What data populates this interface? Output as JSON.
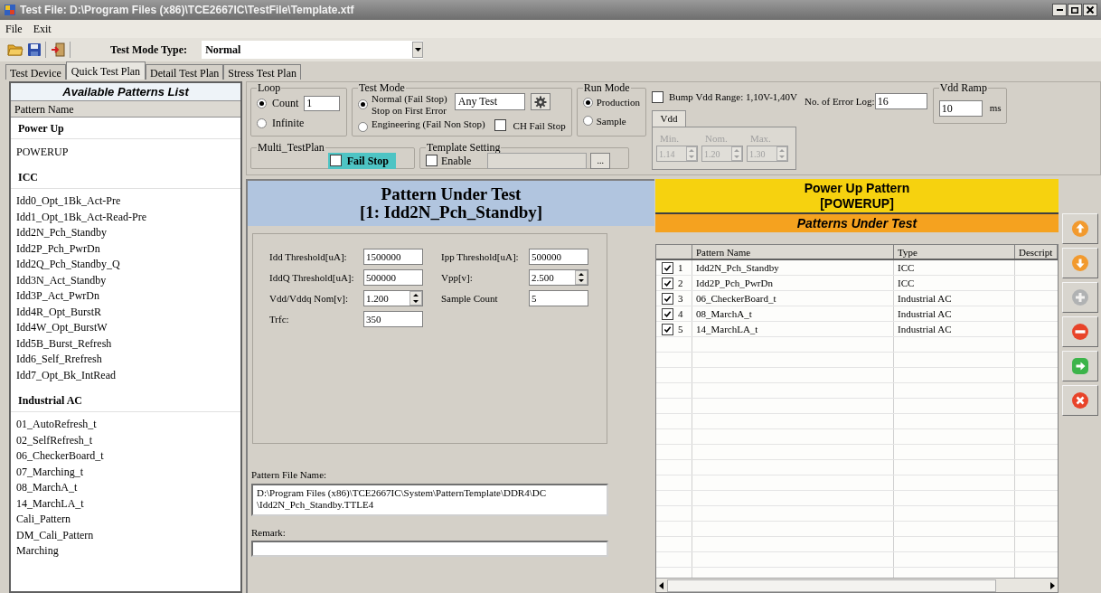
{
  "window": {
    "title": "Test File: D:\\Program Files (x86)\\TCE2667IC\\TestFile\\Template.xtf"
  },
  "menu": [
    "File",
    "Exit"
  ],
  "toolbar": {
    "mode_label": "Test Mode Type:",
    "mode_value": "Normal"
  },
  "tabs": [
    {
      "label": "Test Device",
      "selected": false
    },
    {
      "label": "Quick Test Plan",
      "selected": true
    },
    {
      "label": "Detail Test Plan",
      "selected": false
    },
    {
      "label": "Stress Test Plan",
      "selected": false
    }
  ],
  "patterns_list": {
    "title": "Available Patterns List",
    "column": "Pattern Name",
    "groups": [
      {
        "name": "Power Up",
        "items": [
          "POWERUP"
        ]
      },
      {
        "name": "ICC",
        "items": [
          "Idd0_Opt_1Bk_Act-Pre",
          "Idd1_Opt_1Bk_Act-Read-Pre",
          "Idd2N_Pch_Standby",
          "Idd2P_Pch_PwrDn",
          "Idd2Q_Pch_Standby_Q",
          "Idd3N_Act_Standby",
          "Idd3P_Act_PwrDn",
          "Idd4R_Opt_BurstR",
          "Idd4W_Opt_BurstW",
          "Idd5B_Burst_Refresh",
          "Idd6_Self_Rrefresh",
          "Idd7_Opt_Bk_IntRead"
        ]
      },
      {
        "name": "Industrial AC",
        "items": [
          "01_AutoRefresh_t",
          "02_SelfRefresh_t",
          "06_CheckerBoard_t",
          "07_Marching_t",
          "08_MarchA_t",
          "14_MarchLA_t",
          "Cali_Pattern",
          "DM_Cali_Pattern",
          "Marching"
        ]
      }
    ]
  },
  "loop": {
    "title": "Loop",
    "options": [
      {
        "label": "Count",
        "selected": true
      },
      {
        "label": "Infinite",
        "selected": false
      }
    ],
    "count": "1"
  },
  "test_mode": {
    "title": "Test Mode",
    "options": [
      {
        "label": "Normal (Fail Stop)",
        "note": "Stop on First Error",
        "selected": true
      },
      {
        "label": "Engineering (Fail Non Stop)",
        "selected": false
      }
    ],
    "filter": "Any Test",
    "ch_fail_stop": {
      "label": "CH Fail Stop",
      "checked": false
    }
  },
  "run_mode": {
    "title": "Run Mode",
    "options": [
      {
        "label": "Production",
        "selected": true
      },
      {
        "label": "Sample",
        "selected": false
      }
    ]
  },
  "multi_testplan": {
    "title": "Multi_TestPlan",
    "fail_stop": {
      "label": "Fail Stop",
      "checked": false
    }
  },
  "template_setting": {
    "title": "Template Setting",
    "enable": {
      "label": "Enable",
      "checked": false
    },
    "browse": "..."
  },
  "bump_vdd": {
    "label": "Bump Vdd Range: 1,10V-1,40V",
    "checked": false
  },
  "vdd": {
    "tab": "Vdd",
    "disabled": true,
    "fields": [
      {
        "label": "Min.",
        "value": "1.14"
      },
      {
        "label": "Nom.",
        "value": "1.20"
      },
      {
        "label": "Max.",
        "value": "1.30"
      }
    ]
  },
  "error_log": {
    "label": "No. of Error Log:",
    "value": "16"
  },
  "vdd_ramp": {
    "title": "Vdd Ramp",
    "value": "10",
    "unit": "ms"
  },
  "pattern_under_test": {
    "title": "Pattern Under Test",
    "subtitle": "[1: Idd2N_Pch_Standby]",
    "params": [
      {
        "label": "Idd Threshold[uA]:",
        "value": "1500000",
        "kind": "text"
      },
      {
        "label": "Ipp Threshold[uA]:",
        "value": "500000",
        "kind": "text"
      },
      {
        "label": "IddQ Threshold[uA]:",
        "value": "500000",
        "kind": "text"
      },
      {
        "label": "Vpp[v]:",
        "value": "2.500",
        "kind": "spin"
      },
      {
        "label": "Vdd/Vddq Nom[v]:",
        "value": "1.200",
        "kind": "spin"
      },
      {
        "label": "Sample Count",
        "value": "5",
        "kind": "text"
      },
      {
        "label": "Trfc:",
        "value": "350",
        "kind": "text"
      }
    ],
    "file_label": "Pattern File Name:",
    "file_lines": [
      "D:\\Program Files (x86)\\TCE2667IC\\System\\PatternTemplate\\DDR4\\DC",
      "\\Idd2N_Pch_Standby.TTLE4"
    ],
    "remark_label": "Remark:"
  },
  "power_up": {
    "title": "Power Up Pattern",
    "subtitle": "[POWERUP]",
    "list_title": "Patterns Under Test",
    "columns": [
      "Pattern Name",
      "Type",
      "Descript"
    ],
    "rows": [
      {
        "checked": true,
        "index": "1",
        "name": "Idd2N_Pch_Standby",
        "type": "ICC"
      },
      {
        "checked": true,
        "index": "2",
        "name": "Idd2P_Pch_PwrDn",
        "type": "ICC"
      },
      {
        "checked": true,
        "index": "3",
        "name": "06_CheckerBoard_t",
        "type": "Industrial AC"
      },
      {
        "checked": true,
        "index": "4",
        "name": "08_MarchA_t",
        "type": "Industrial AC"
      },
      {
        "checked": true,
        "index": "5",
        "name": "14_MarchLA_t",
        "type": "Industrial AC"
      }
    ]
  },
  "side_buttons": [
    {
      "kind": "up",
      "disabled": false
    },
    {
      "kind": "down",
      "disabled": false
    },
    {
      "kind": "add",
      "disabled": true
    },
    {
      "kind": "remove",
      "disabled": false
    },
    {
      "kind": "go",
      "disabled": false
    },
    {
      "kind": "clear",
      "disabled": false
    }
  ]
}
